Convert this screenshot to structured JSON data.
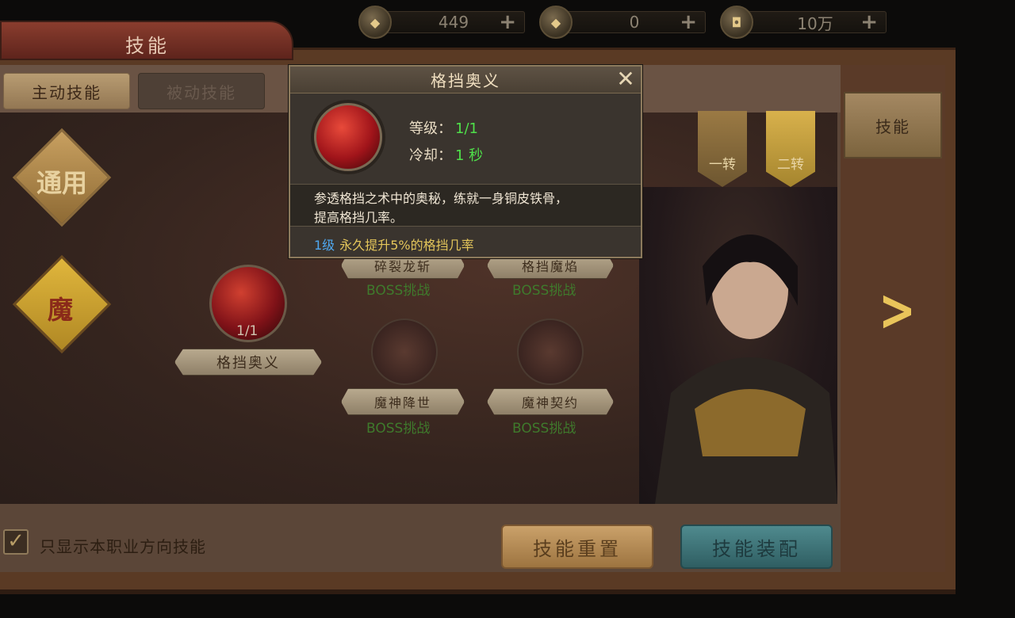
{
  "currency": [
    {
      "icon": "gold-ingot-icon",
      "value": "449"
    },
    {
      "icon": "bound-ingot-icon",
      "value": "0"
    },
    {
      "icon": "coin-icon",
      "value": "10万"
    }
  ],
  "window": {
    "title": "技能"
  },
  "tabs": [
    {
      "label": "主动技能",
      "active": true
    },
    {
      "label": "被动技能",
      "active": false
    }
  ],
  "categories": [
    {
      "label": "通用"
    },
    {
      "label": "魔"
    }
  ],
  "ranks": [
    {
      "label": "一转",
      "highlighted": false
    },
    {
      "label": "二转",
      "highlighted": true
    }
  ],
  "skills": [
    {
      "name": "格挡奥义",
      "level": "1/1",
      "unlocked": true
    },
    {
      "name": "碎裂龙斩",
      "condition": "BOSS挑战"
    },
    {
      "name": "格挡魔焰",
      "condition": "BOSS挑战"
    },
    {
      "name": "魔神降世",
      "condition": "BOSS挑战"
    },
    {
      "name": "魔神契约",
      "condition": "BOSS挑战"
    }
  ],
  "right_panel": {
    "tab_label": "技能"
  },
  "filter": {
    "label": "只显示本职业方向技能",
    "checked": true
  },
  "buttons": {
    "reset": "技能重置",
    "equip": "技能装配"
  },
  "popup": {
    "title": "格挡奥义",
    "level_label": "等级：",
    "level_value": "1/1",
    "cooldown_label": "冷却：",
    "cooldown_value": "1 秒",
    "description_line1": "参透格挡之术中的奥秘，练就一身铜皮铁骨，",
    "description_line2": "提高格挡几率。",
    "effect_level": "1级",
    "effect_text": "永久提升5%的格挡几率"
  },
  "colors": {
    "accent_gold": "#e9c45a",
    "green_value": "#4fe04a",
    "boss_green": "#3f7a2c",
    "level_blue": "#4fa8f0"
  }
}
